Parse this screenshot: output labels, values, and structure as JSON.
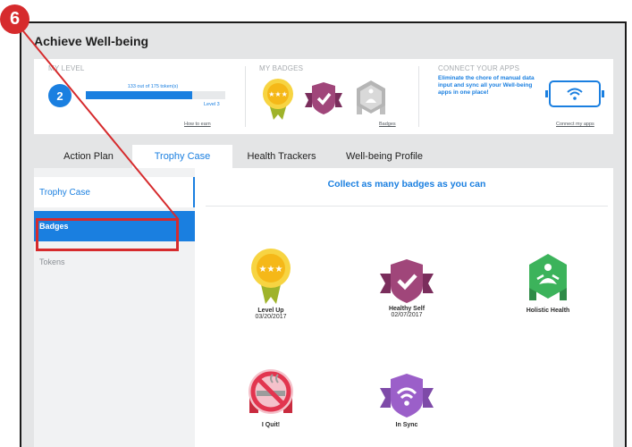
{
  "app": {
    "title": "Achieve Well-being"
  },
  "level": {
    "label": "MY LEVEL",
    "value": "2",
    "tokens_text": "133 out of 175 token(s)",
    "progress_fraction": 0.76,
    "next_level": "Level 3",
    "how_to_earn": "How to earn"
  },
  "badges_summary": {
    "label": "MY BADGES",
    "link": "Badges"
  },
  "connect": {
    "label": "CONNECT YOUR APPS",
    "text": "Eliminate the chore of manual data input and sync all your Well-being apps in one place!",
    "link": "Connect my apps"
  },
  "tabs": [
    {
      "label": "Action Plan",
      "active": false
    },
    {
      "label": "Trophy Case",
      "active": true
    },
    {
      "label": "Health Trackers",
      "active": false
    },
    {
      "label": "Well-being Profile",
      "active": false
    }
  ],
  "sidebar": {
    "heading": "Trophy Case",
    "items": [
      {
        "label": "Badges",
        "selected": true
      },
      {
        "label": "Tokens",
        "selected": false
      }
    ]
  },
  "main": {
    "heading": "Collect as many badges as you can",
    "badges": [
      {
        "name": "Level Up",
        "date": "03/20/2017",
        "icon": "gold-medal-stars-icon"
      },
      {
        "name": "Healthy Self",
        "date": "02/07/2017",
        "icon": "purple-shield-check-icon"
      },
      {
        "name": "Holistic Health",
        "date": "",
        "icon": "green-hexagon-meditation-icon"
      },
      {
        "name": "I Quit!",
        "date": "",
        "icon": "no-smoking-icon"
      },
      {
        "name": "In Sync",
        "date": "",
        "icon": "wifi-shield-icon"
      }
    ]
  },
  "annotation": {
    "number": "6"
  },
  "colors": {
    "accent": "#1a7fe0",
    "annotation": "#d62b2d",
    "gold": "#f5c518",
    "purple": "#a0467a",
    "green": "#3cb35b"
  }
}
